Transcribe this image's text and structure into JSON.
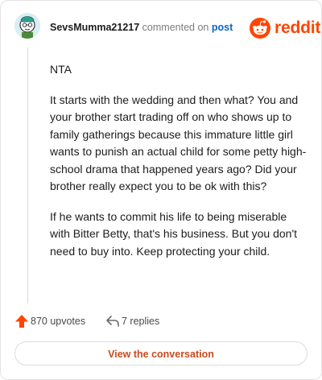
{
  "comment": {
    "username": "SevsMumma21217",
    "action_text": "commented on",
    "post_link": "post",
    "brand_name": "reddit",
    "paragraphs": [
      "NTA",
      "It starts with the wedding and then what? You and your brother start trading off on who shows up to family gatherings because this immature little girl wants to punish an actual child for some petty high-school drama that happened years ago? Did your brother really expect you to be ok with this?",
      "If he wants to commit his life to being miserable with Bitter Betty, that's his business. But you don't need to buy into. Keep protecting your child."
    ],
    "upvotes": "870 upvotes",
    "replies": "7 replies",
    "cta_label": "View the conversation"
  },
  "colors": {
    "brand": "#ff4500",
    "link": "#0a66c2",
    "cta_text": "#c94b1e"
  },
  "icons": [
    "avatar",
    "reddit-logo-icon",
    "upvote-arrow-icon",
    "reply-arrow-icon"
  ]
}
